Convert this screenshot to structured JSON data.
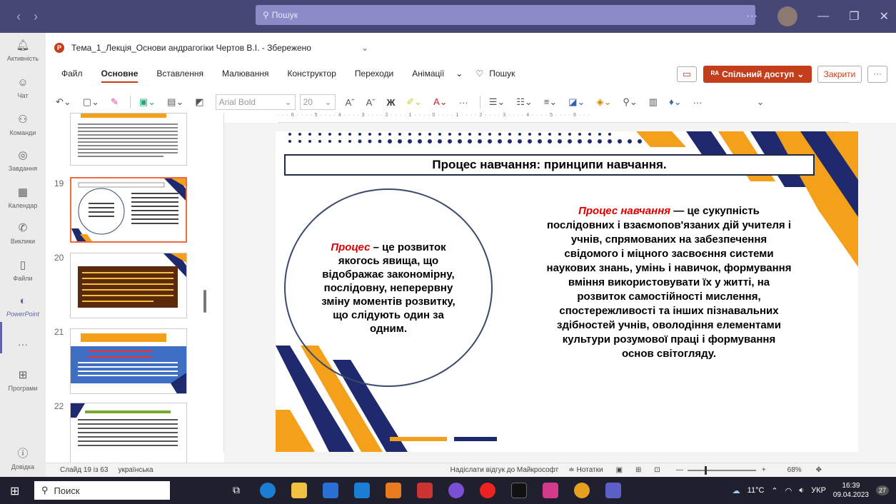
{
  "teams": {
    "search_placeholder": "Пошук",
    "nav_back": "‹",
    "nav_forward": "›",
    "more": "···",
    "rail": [
      {
        "label": "Активність",
        "icon": "bell-icon"
      },
      {
        "label": "Чат",
        "icon": "chat-icon"
      },
      {
        "label": "Команди",
        "icon": "teams-icon"
      },
      {
        "label": "Завдання",
        "icon": "assignments-icon"
      },
      {
        "label": "Календар",
        "icon": "calendar-icon"
      },
      {
        "label": "Виклики",
        "icon": "phone-icon"
      },
      {
        "label": "Файли",
        "icon": "file-icon"
      },
      {
        "label": "PowerPoint",
        "icon": "powerpoint-icon"
      },
      {
        "label": "···",
        "icon": "more-icon"
      },
      {
        "label": "Програми",
        "icon": "apps-icon"
      },
      {
        "label": "Довідка",
        "icon": "help-icon"
      }
    ]
  },
  "document": {
    "title": "Тема_1_Лекція_Основи андрагогіки Чертов В.І. - Збережено",
    "dropdown": "⌄"
  },
  "menu": {
    "tabs": [
      "Файл",
      "Основне",
      "Вставлення",
      "Малювання",
      "Конструктор",
      "Переходи",
      "Анімації"
    ],
    "active_tab": "Основне",
    "more": "⌄",
    "search": "Пошук",
    "share": "Спільний доступ",
    "close": "Закрити",
    "overflow": "···"
  },
  "toolbar": {
    "font_name": "Arial Bold",
    "font_size": "20",
    "bold_glyph": "Ж"
  },
  "thumbnails": [
    {
      "num": "",
      "selected": false
    },
    {
      "num": "19",
      "selected": true
    },
    {
      "num": "20",
      "selected": false
    },
    {
      "num": "21",
      "selected": false
    },
    {
      "num": "22",
      "selected": false
    }
  ],
  "ruler": "· · · 6 · · · · 5 · · · · 4 · · · · 3 · · · · 2 · · · · 1 · · · · 0 · · · · 1 · · · · 2 · · · · 3 · · · · 4 · · · · 5 · · · · 6 · · ·",
  "slide": {
    "title": "Процес навчання: принципи навчання.",
    "left_term": "Процес",
    "left_text": " – це розвиток якогось явища, що відображає закономірну, послідовну, неперервну зміну моментів розвитку, що слідують один за одним.",
    "right_term": "Процес навчання",
    "right_text": " — це сукупність послідовних і взаємопов'язаних дій учителя і учнів, спрямованих на забезпечення свідомого і міцного засвоєння системи наукових знань, умінь і навичок, формування вміння використовувати їх у житті, на розвиток самостійності мислення, спостережливості та інших пізнавальних здібностей учнів, оволодіння елементами культури розумової праці і формування основ світогляду."
  },
  "status": {
    "slide_info": "Слайд 19 із 63",
    "language": "українська",
    "feedback": "Надіслати відгук до Майкрософт",
    "notes": "Нотатки",
    "zoom": "68%"
  },
  "taskbar": {
    "search": "Поиск",
    "weather": "11°C",
    "lang": "УКР",
    "time": "16:39",
    "date": "09.04.2023",
    "notifications": "27"
  },
  "colors": {
    "teams_purple": "#464775",
    "accent_orange": "#c43e1c",
    "slide_navy": "#1f2a6e",
    "slide_orange": "#f5a01a"
  }
}
